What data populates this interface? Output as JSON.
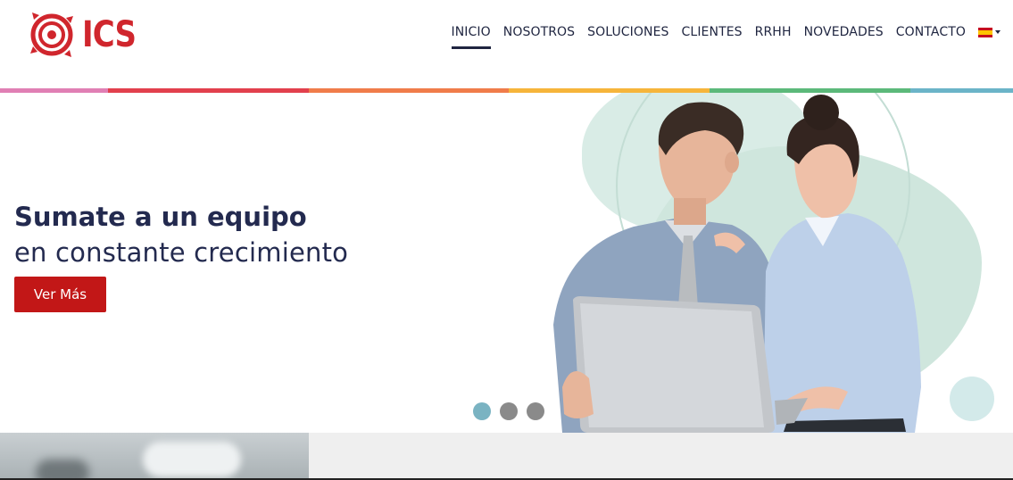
{
  "brand": {
    "logo_text": "ICS",
    "logo_color": "#d0262d"
  },
  "nav": {
    "items": [
      {
        "label": "INICIO",
        "active": true
      },
      {
        "label": "NOSOTROS",
        "active": false
      },
      {
        "label": "SOLUCIONES",
        "active": false
      },
      {
        "label": "CLIENTES",
        "active": false
      },
      {
        "label": "RRHH",
        "active": false
      },
      {
        "label": "NOVEDADES",
        "active": false
      },
      {
        "label": "CONTACTO",
        "active": false
      }
    ],
    "language_icon": "spain-flag-icon"
  },
  "strip_colors": [
    "#e07fb4",
    "#e2404d",
    "#f07c4a",
    "#f6b53b",
    "#5cb97a",
    "#6bb4c8"
  ],
  "hero": {
    "title": "Sumate a un equipo",
    "subtitle": "en constante crecimiento",
    "cta_label": "Ver Más",
    "cta_color": "#c21717"
  },
  "carousel": {
    "slide_count": 3,
    "active_index": 0
  }
}
